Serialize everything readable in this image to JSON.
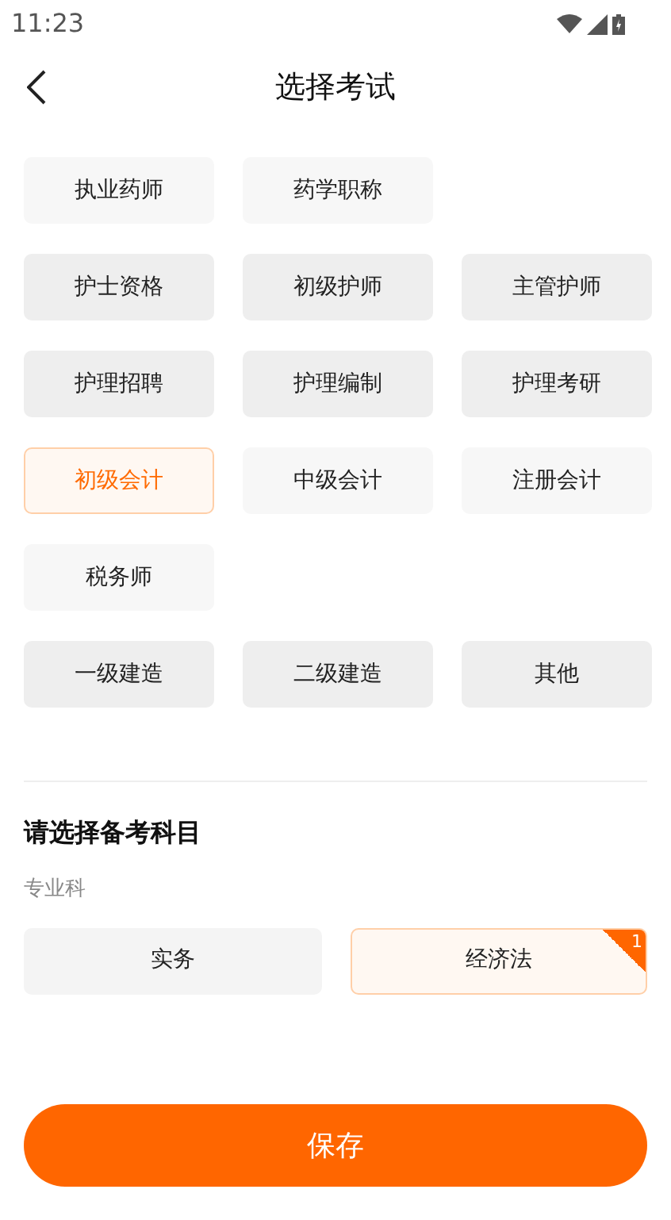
{
  "status_bar": {
    "time": "11:23"
  },
  "header": {
    "title": "选择考试"
  },
  "exam_groups": [
    {
      "color": "#f7f7f7",
      "items": [
        {
          "label": "执业药师",
          "selected": false
        },
        {
          "label": "药学职称",
          "selected": false
        }
      ]
    },
    {
      "color": "#eeeeee",
      "items": [
        {
          "label": "护士资格",
          "selected": false
        },
        {
          "label": "初级护师",
          "selected": false
        },
        {
          "label": "主管护师",
          "selected": false
        },
        {
          "label": "护理招聘",
          "selected": false
        },
        {
          "label": "护理编制",
          "selected": false
        },
        {
          "label": "护理考研",
          "selected": false
        }
      ]
    },
    {
      "color": "#f7f7f7",
      "items": [
        {
          "label": "初级会计",
          "selected": true
        },
        {
          "label": "中级会计",
          "selected": false
        },
        {
          "label": "注册会计",
          "selected": false
        },
        {
          "label": "税务师",
          "selected": false
        }
      ]
    },
    {
      "color": "#eeeeee",
      "items": [
        {
          "label": "一级建造",
          "selected": false
        },
        {
          "label": "二级建造",
          "selected": false
        },
        {
          "label": "其他",
          "selected": false
        }
      ]
    }
  ],
  "subjects_section": {
    "title": "请选择备考科目",
    "category": "专业科",
    "subjects": [
      {
        "label": "实务",
        "selected": false
      },
      {
        "label": "经济法",
        "selected": true,
        "badge": "1"
      }
    ]
  },
  "save_button": {
    "label": "保存"
  }
}
